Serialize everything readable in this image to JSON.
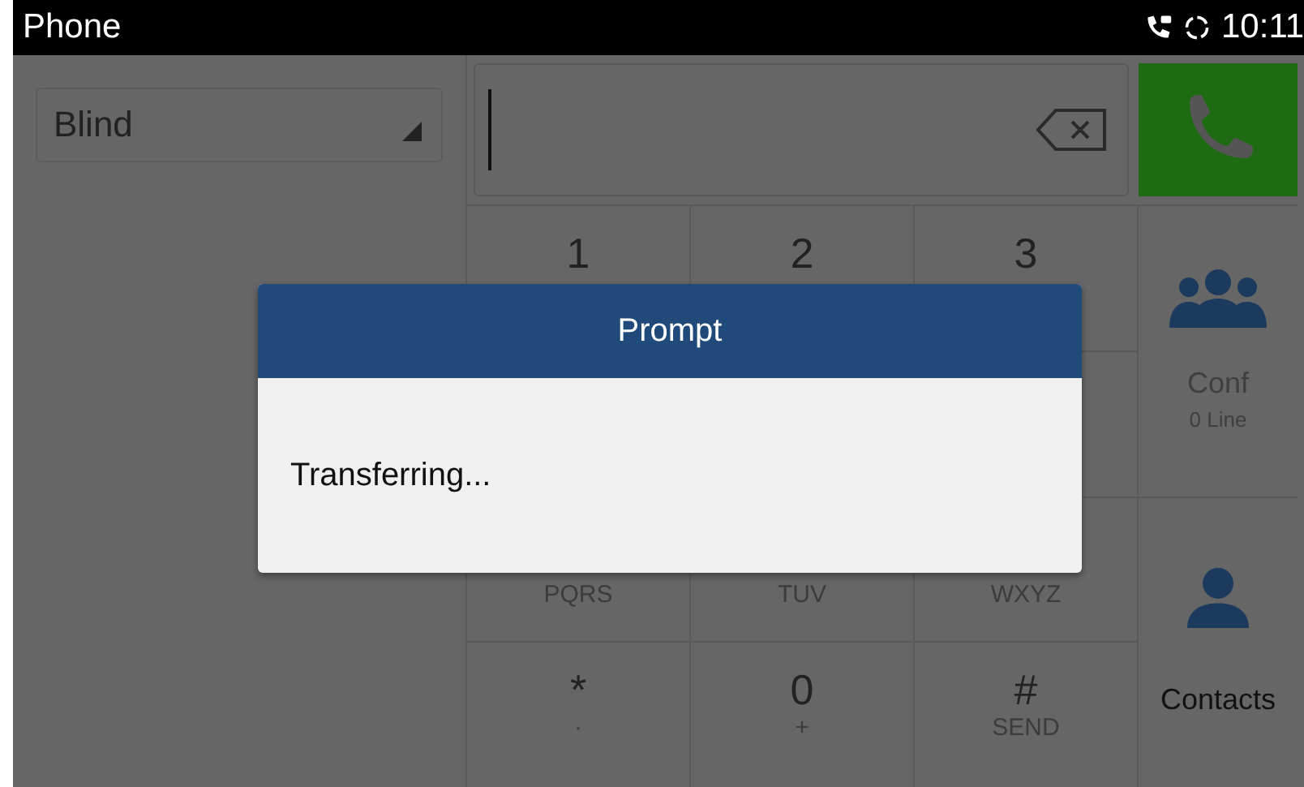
{
  "status_bar": {
    "title": "Phone",
    "time": "10:11"
  },
  "transfer_mode": {
    "value": "Blind"
  },
  "keypad": [
    [
      {
        "digit": "1"
      },
      {
        "digit": "2"
      },
      {
        "digit": "3"
      }
    ],
    [
      {
        "letters": "PQRS"
      },
      {
        "letters": "TUV"
      },
      {
        "letters": "WXYZ"
      }
    ],
    [
      {
        "digit": "*",
        "letters": "·"
      },
      {
        "digit": "0",
        "letters": "+"
      },
      {
        "digit": "#",
        "letters": "SEND"
      }
    ]
  ],
  "side_buttons": [
    {
      "kind": "conf",
      "label": "Conf",
      "sublabel": "0 Line",
      "disabled": true
    },
    {
      "kind": "contacts",
      "label": "Contacts",
      "disabled": false
    }
  ],
  "dialog": {
    "title": "Prompt",
    "message": "Transferring..."
  }
}
